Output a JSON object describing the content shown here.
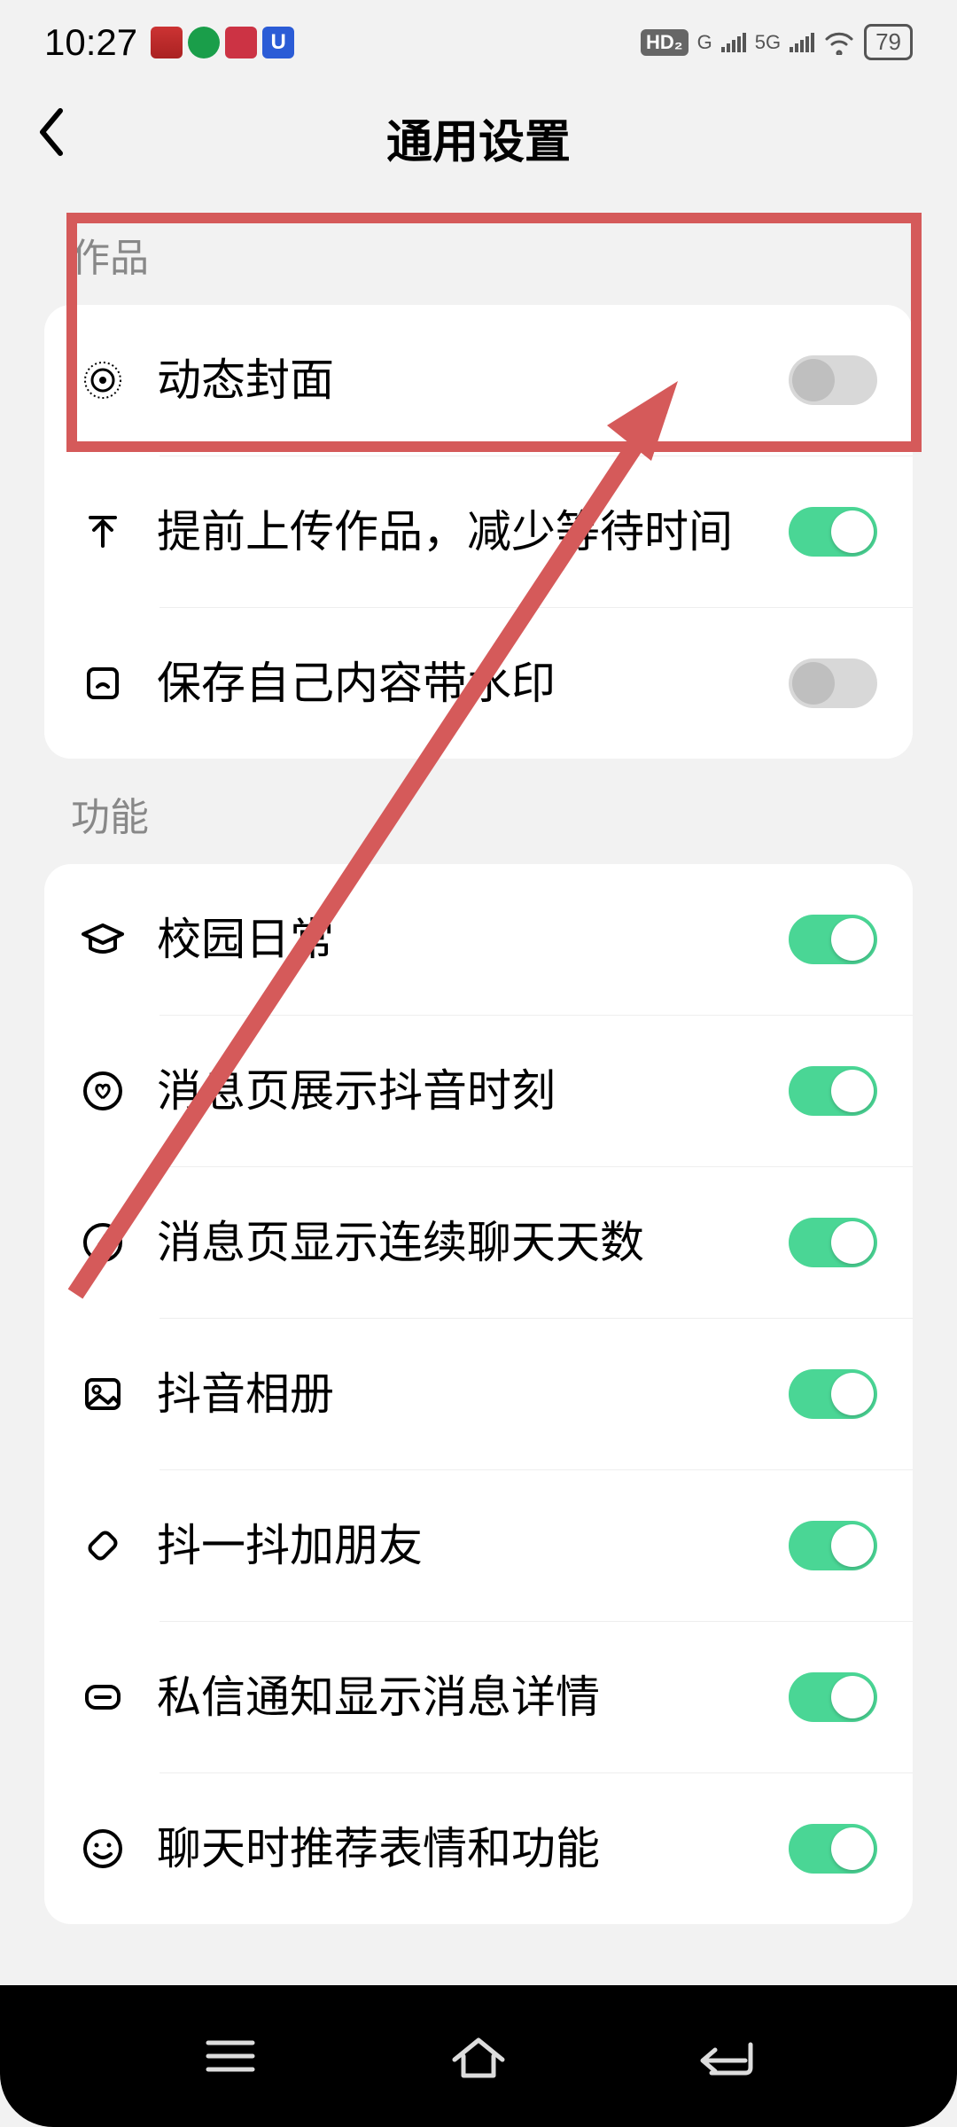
{
  "status": {
    "time": "10:27",
    "hd": "HD₂",
    "g": "G",
    "g5": "5G",
    "battery": "79"
  },
  "nav": {
    "title": "通用设置"
  },
  "sections": [
    {
      "label": "作品",
      "items": [
        {
          "icon": "target",
          "label": "动态封面",
          "on": false
        },
        {
          "icon": "upload",
          "label": "提前上传作品，减少等待时间",
          "on": true
        },
        {
          "icon": "save",
          "label": "保存自己内容带水印",
          "on": false
        }
      ]
    },
    {
      "label": "功能",
      "items": [
        {
          "icon": "cap",
          "label": "校园日常",
          "on": true
        },
        {
          "icon": "heart",
          "label": "消息页展示抖音时刻",
          "on": true
        },
        {
          "icon": "bolt",
          "label": "消息页显示连续聊天天数",
          "on": true
        },
        {
          "icon": "image",
          "label": "抖音相册",
          "on": true
        },
        {
          "icon": "shake",
          "label": "抖一抖加朋友",
          "on": true
        },
        {
          "icon": "msg",
          "label": "私信通知显示消息详情",
          "on": true
        },
        {
          "icon": "smile",
          "label": "聊天时推荐表情和功能",
          "on": true
        }
      ]
    }
  ],
  "colors": {
    "accent_on": "#4ad695",
    "annotation": "#d55a5a"
  }
}
